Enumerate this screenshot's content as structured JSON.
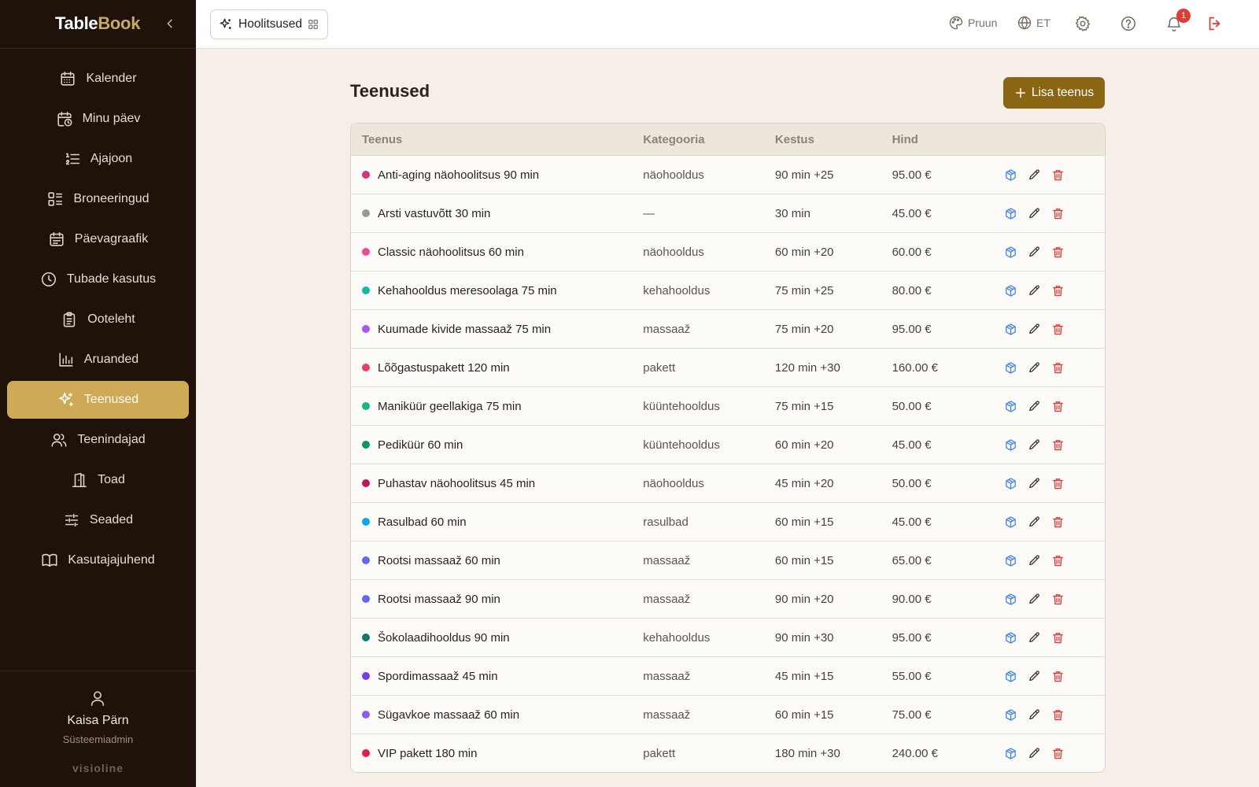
{
  "brand": {
    "part1": "Table",
    "part2": "Book"
  },
  "sidebar": {
    "items": [
      {
        "label": "Kalender",
        "icon": "calendar-icon"
      },
      {
        "label": "Minu päev",
        "icon": "calendar-clock-icon"
      },
      {
        "label": "Ajajoon",
        "icon": "list-ordered-icon"
      },
      {
        "label": "Broneeringud",
        "icon": "layout-list-icon"
      },
      {
        "label": "Päevagraafik",
        "icon": "calendar-days-icon"
      },
      {
        "label": "Tubade kasutus",
        "icon": "clock-icon"
      },
      {
        "label": "Ooteleht",
        "icon": "clipboard-icon"
      },
      {
        "label": "Aruanded",
        "icon": "bar-chart-icon"
      },
      {
        "label": "Teenused",
        "icon": "sparkles-icon",
        "active": true
      },
      {
        "label": "Teenindajad",
        "icon": "users-icon"
      },
      {
        "label": "Toad",
        "icon": "door-icon"
      },
      {
        "label": "Seaded",
        "icon": "sliders-icon"
      },
      {
        "label": "Kasutajajuhend",
        "icon": "book-icon"
      }
    ],
    "user": {
      "name": "Kaisa Pärn",
      "role": "Süsteemiadmin"
    },
    "vendor": "visioline"
  },
  "topbar": {
    "module": "Hoolitsused",
    "theme": "Pruun",
    "language": "ET",
    "notifications_count": "1"
  },
  "main": {
    "title": "Teenused",
    "add_label": "Lisa teenus",
    "columns": [
      "Teenus",
      "Kategooria",
      "Kestus",
      "Hind"
    ],
    "rows": [
      {
        "name": "Anti-aging näohoolitsus 90 min",
        "category": "näohooldus",
        "duration": "90 min +25",
        "price": "95.00 €",
        "color": "#d6337a"
      },
      {
        "name": "Arsti vastuvõtt 30 min",
        "category": "—",
        "duration": "30 min",
        "price": "45.00 €",
        "color": "#9a9a9a"
      },
      {
        "name": "Classic näohoolitsus 60 min",
        "category": "näohooldus",
        "duration": "60 min +20",
        "price": "60.00 €",
        "color": "#e94f97"
      },
      {
        "name": "Kehahooldus meresoolaga 75 min",
        "category": "kehahooldus",
        "duration": "75 min +25",
        "price": "80.00 €",
        "color": "#14b8a6"
      },
      {
        "name": "Kuumade kivide massaaž 75 min",
        "category": "massaaž",
        "duration": "75 min +20",
        "price": "95.00 €",
        "color": "#a855f7"
      },
      {
        "name": "Lõõgastuspakett 120 min",
        "category": "pakett",
        "duration": "120 min +30",
        "price": "160.00 €",
        "color": "#e5405e"
      },
      {
        "name": "Maniküür geellakiga 75 min",
        "category": "küüntehooldus",
        "duration": "75 min +15",
        "price": "50.00 €",
        "color": "#10b981"
      },
      {
        "name": "Pediküür 60 min",
        "category": "küüntehooldus",
        "duration": "60 min +20",
        "price": "45.00 €",
        "color": "#059669"
      },
      {
        "name": "Puhastav näohoolitsus 45 min",
        "category": "näohooldus",
        "duration": "45 min +20",
        "price": "50.00 €",
        "color": "#be185d"
      },
      {
        "name": "Rasulbad 60 min",
        "category": "rasulbad",
        "duration": "60 min +15",
        "price": "45.00 €",
        "color": "#0ea5e9"
      },
      {
        "name": "Rootsi massaaž 60 min",
        "category": "massaaž",
        "duration": "60 min +15",
        "price": "65.00 €",
        "color": "#6366f1"
      },
      {
        "name": "Rootsi massaaž 90 min",
        "category": "massaaž",
        "duration": "90 min +20",
        "price": "90.00 €",
        "color": "#6366f1"
      },
      {
        "name": "Šokolaadihooldus 90 min",
        "category": "kehahooldus",
        "duration": "90 min +30",
        "price": "95.00 €",
        "color": "#0f766e"
      },
      {
        "name": "Spordimassaaž 45 min",
        "category": "massaaž",
        "duration": "45 min +15",
        "price": "55.00 €",
        "color": "#7c3aed"
      },
      {
        "name": "Sügavkoe massaaž 60 min",
        "category": "massaaž",
        "duration": "60 min +15",
        "price": "75.00 €",
        "color": "#8b5cf6"
      },
      {
        "name": "VIP pakett 180 min",
        "category": "pakett",
        "duration": "180 min +30",
        "price": "240.00 €",
        "color": "#e11d48"
      }
    ]
  },
  "colors": {
    "sidebar_bg": "#1e120a",
    "accent": "#cfaa56",
    "primary_button": "#8a6514",
    "page_bg": "#f5efe7"
  }
}
